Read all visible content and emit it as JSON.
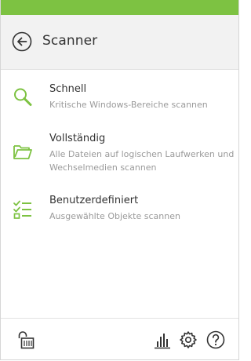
{
  "accent_color": "#7dc242",
  "header": {
    "back_icon": "arrow-left-circle-icon",
    "title": "Scanner"
  },
  "menu": {
    "items": [
      {
        "icon": "magnifier-icon",
        "title": "Schnell",
        "description": "Kritische Windows-Bereiche scannen"
      },
      {
        "icon": "folder-icon",
        "title": "Vollständig",
        "description": "Alle Dateien auf logischen Laufwerken und Wechselmedien scannen"
      },
      {
        "icon": "checklist-icon",
        "title": "Benutzerdefiniert",
        "description": "Ausgewählte Objekte scannen"
      }
    ]
  },
  "footer": {
    "icons": [
      "unlock-icon",
      "bar-chart-icon",
      "gear-icon",
      "help-icon"
    ]
  }
}
